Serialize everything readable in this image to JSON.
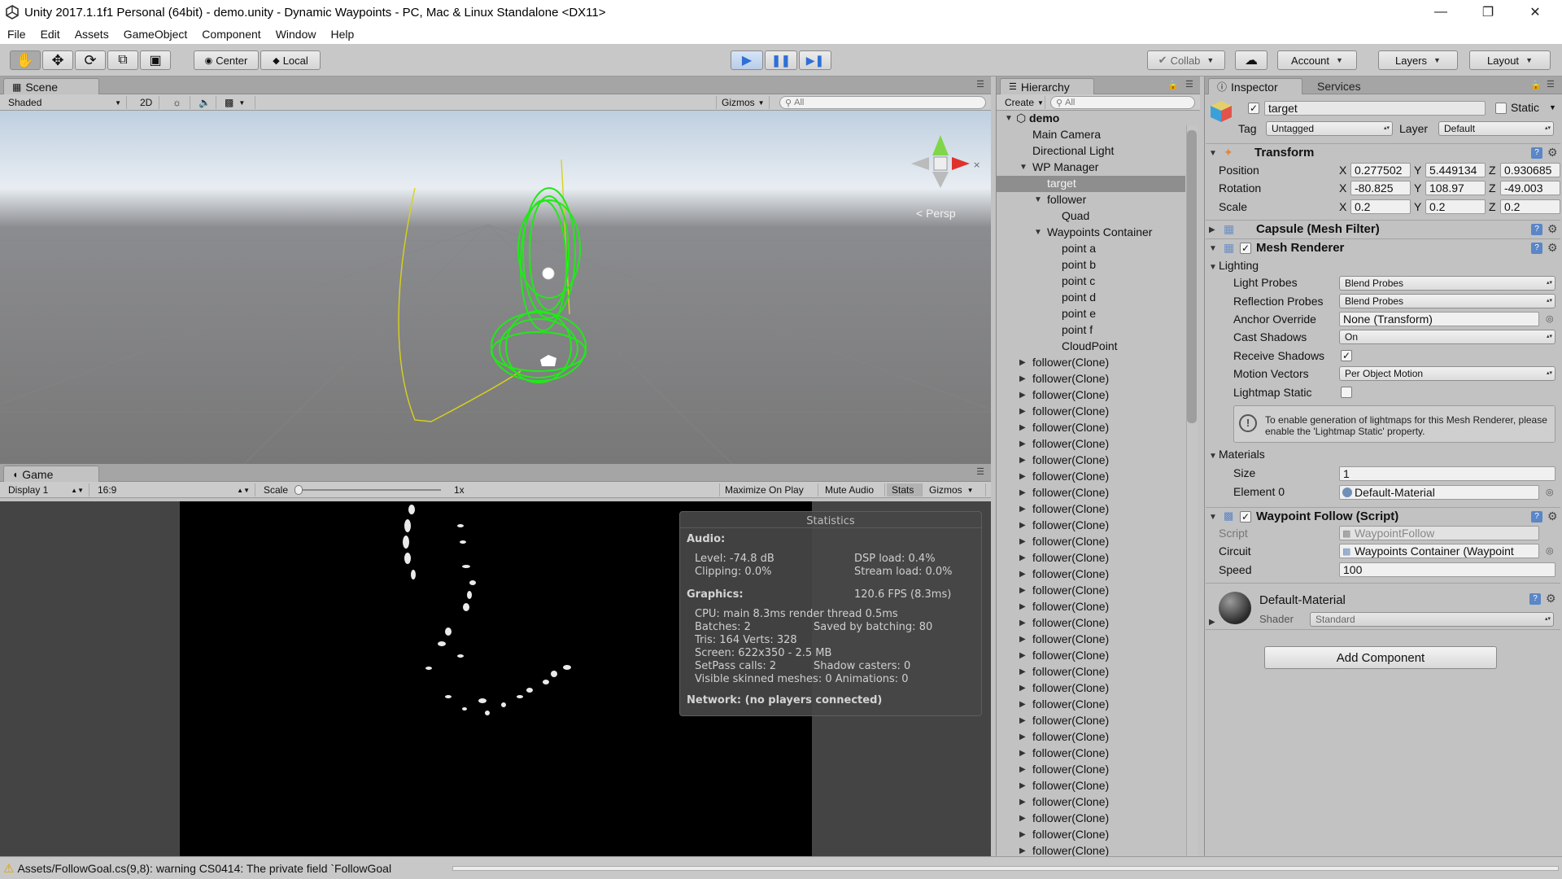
{
  "window": {
    "title": "Unity 2017.1.1f1 Personal (64bit) - demo.unity - Dynamic Waypoints - PC, Mac & Linux Standalone <DX11>"
  },
  "menu": [
    "File",
    "Edit",
    "Assets",
    "GameObject",
    "Component",
    "Window",
    "Help"
  ],
  "toolbar": {
    "pivot": "Center",
    "space": "Local",
    "collab": "Collab",
    "account": "Account",
    "layers": "Layers",
    "layout": "Layout"
  },
  "scene": {
    "tab": "Scene",
    "shading": "Shaded",
    "mode2d": "2D",
    "gizmos": "Gizmos",
    "search_placeholder": "All",
    "persp": "Persp"
  },
  "game": {
    "tab": "Game",
    "display": "Display 1",
    "aspect": "16:9",
    "scale_label": "Scale",
    "scale_value": "1x",
    "maximize": "Maximize On Play",
    "mute": "Mute Audio",
    "stats": "Stats",
    "gizmos": "Gizmos"
  },
  "statistics": {
    "title": "Statistics",
    "audio_label": "Audio:",
    "level": "Level: -74.8 dB",
    "dsp": "DSP load: 0.4%",
    "clipping": "Clipping: 0.0%",
    "stream": "Stream load: 0.0%",
    "graphics_label": "Graphics:",
    "fps": "120.6 FPS (8.3ms)",
    "cpu": "CPU: main 8.3ms  render thread 0.5ms",
    "batches": "Batches: 2",
    "saved": "Saved by batching: 80",
    "tris": "Tris: 164  Verts: 328",
    "screen": "Screen: 622x350 - 2.5 MB",
    "setpass": "SetPass calls: 2",
    "shadow": "Shadow casters: 0",
    "skinned": "Visible skinned meshes: 0  Animations: 0",
    "network": "Network: (no players connected)"
  },
  "hierarchy": {
    "tab": "Hierarchy",
    "create": "Create",
    "search_placeholder": "All",
    "items": [
      {
        "label": "demo",
        "indent": 0,
        "arrow": "open",
        "bold": true
      },
      {
        "label": "Main Camera",
        "indent": 1
      },
      {
        "label": "Directional Light",
        "indent": 1
      },
      {
        "label": "WP Manager",
        "indent": 1,
        "arrow": "open"
      },
      {
        "label": "target",
        "indent": 2,
        "selected": true
      },
      {
        "label": "follower",
        "indent": 2,
        "arrow": "open"
      },
      {
        "label": "Quad",
        "indent": 3
      },
      {
        "label": "Waypoints Container",
        "indent": 2,
        "arrow": "open"
      },
      {
        "label": "point a",
        "indent": 3
      },
      {
        "label": "point b",
        "indent": 3
      },
      {
        "label": "point c",
        "indent": 3
      },
      {
        "label": "point d",
        "indent": 3
      },
      {
        "label": "point e",
        "indent": 3
      },
      {
        "label": "point f",
        "indent": 3
      },
      {
        "label": "CloudPoint",
        "indent": 3
      },
      {
        "label": "follower(Clone)",
        "indent": 1,
        "arrow": "closed"
      },
      {
        "label": "follower(Clone)",
        "indent": 1,
        "arrow": "closed"
      },
      {
        "label": "follower(Clone)",
        "indent": 1,
        "arrow": "closed"
      },
      {
        "label": "follower(Clone)",
        "indent": 1,
        "arrow": "closed"
      },
      {
        "label": "follower(Clone)",
        "indent": 1,
        "arrow": "closed"
      },
      {
        "label": "follower(Clone)",
        "indent": 1,
        "arrow": "closed"
      },
      {
        "label": "follower(Clone)",
        "indent": 1,
        "arrow": "closed"
      },
      {
        "label": "follower(Clone)",
        "indent": 1,
        "arrow": "closed"
      },
      {
        "label": "follower(Clone)",
        "indent": 1,
        "arrow": "closed"
      },
      {
        "label": "follower(Clone)",
        "indent": 1,
        "arrow": "closed"
      },
      {
        "label": "follower(Clone)",
        "indent": 1,
        "arrow": "closed"
      },
      {
        "label": "follower(Clone)",
        "indent": 1,
        "arrow": "closed"
      },
      {
        "label": "follower(Clone)",
        "indent": 1,
        "arrow": "closed"
      },
      {
        "label": "follower(Clone)",
        "indent": 1,
        "arrow": "closed"
      },
      {
        "label": "follower(Clone)",
        "indent": 1,
        "arrow": "closed"
      },
      {
        "label": "follower(Clone)",
        "indent": 1,
        "arrow": "closed"
      },
      {
        "label": "follower(Clone)",
        "indent": 1,
        "arrow": "closed"
      },
      {
        "label": "follower(Clone)",
        "indent": 1,
        "arrow": "closed"
      },
      {
        "label": "follower(Clone)",
        "indent": 1,
        "arrow": "closed"
      },
      {
        "label": "follower(Clone)",
        "indent": 1,
        "arrow": "closed"
      },
      {
        "label": "follower(Clone)",
        "indent": 1,
        "arrow": "closed"
      },
      {
        "label": "follower(Clone)",
        "indent": 1,
        "arrow": "closed"
      },
      {
        "label": "follower(Clone)",
        "indent": 1,
        "arrow": "closed"
      },
      {
        "label": "follower(Clone)",
        "indent": 1,
        "arrow": "closed"
      },
      {
        "label": "follower(Clone)",
        "indent": 1,
        "arrow": "closed"
      },
      {
        "label": "follower(Clone)",
        "indent": 1,
        "arrow": "closed"
      },
      {
        "label": "follower(Clone)",
        "indent": 1,
        "arrow": "closed"
      },
      {
        "label": "follower(Clone)",
        "indent": 1,
        "arrow": "closed"
      },
      {
        "label": "follower(Clone)",
        "indent": 1,
        "arrow": "closed"
      },
      {
        "label": "follower(Clone)",
        "indent": 1,
        "arrow": "closed"
      },
      {
        "label": "follower(Clone)",
        "indent": 1,
        "arrow": "closed"
      }
    ]
  },
  "inspector": {
    "tab": "Inspector",
    "services_tab": "Services",
    "object_name": "target",
    "static_label": "Static",
    "tag_label": "Tag",
    "tag_value": "Untagged",
    "layer_label": "Layer",
    "layer_value": "Default",
    "transform": {
      "title": "Transform",
      "position_label": "Position",
      "rotation_label": "Rotation",
      "scale_label": "Scale",
      "x": "X",
      "y": "Y",
      "z": "Z",
      "position": [
        "0.277502",
        "5.449134",
        "0.930685"
      ],
      "rotation": [
        "-80.825",
        "108.97",
        "-49.003"
      ],
      "scale": [
        "0.2",
        "0.2",
        "0.2"
      ]
    },
    "mesh_filter": {
      "title": "Capsule (Mesh Filter)"
    },
    "mesh_renderer": {
      "title": "Mesh Renderer",
      "lighting": "Lighting",
      "light_probes_label": "Light Probes",
      "light_probes": "Blend Probes",
      "reflection_probes_label": "Reflection Probes",
      "reflection_probes": "Blend Probes",
      "anchor_label": "Anchor Override",
      "anchor": "None (Transform)",
      "cast_label": "Cast Shadows",
      "cast": "On",
      "receive_label": "Receive Shadows",
      "motion_label": "Motion Vectors",
      "motion": "Per Object Motion",
      "lightmap_label": "Lightmap Static",
      "info": "To enable generation of lightmaps for this Mesh Renderer, please enable the 'Lightmap Static' property.",
      "materials": "Materials",
      "size_label": "Size",
      "size": "1",
      "element_label": "Element 0",
      "element": "Default-Material"
    },
    "waypoint": {
      "title": "Waypoint Follow (Script)",
      "script_label": "Script",
      "script": "WaypointFollow",
      "circuit_label": "Circuit",
      "circuit": "Waypoints Container (Waypoint",
      "speed_label": "Speed",
      "speed": "100"
    },
    "material": {
      "name": "Default-Material",
      "shader_label": "Shader",
      "shader": "Standard"
    },
    "add_component": "Add Component"
  },
  "status": {
    "message": "Assets/FollowGoal.cs(9,8): warning CS0414: The private field `FollowGoal"
  },
  "colors": {
    "selection": "#8e8e8e",
    "play_blue": "#3d7de0",
    "gizmo_green": "#22e81a"
  }
}
